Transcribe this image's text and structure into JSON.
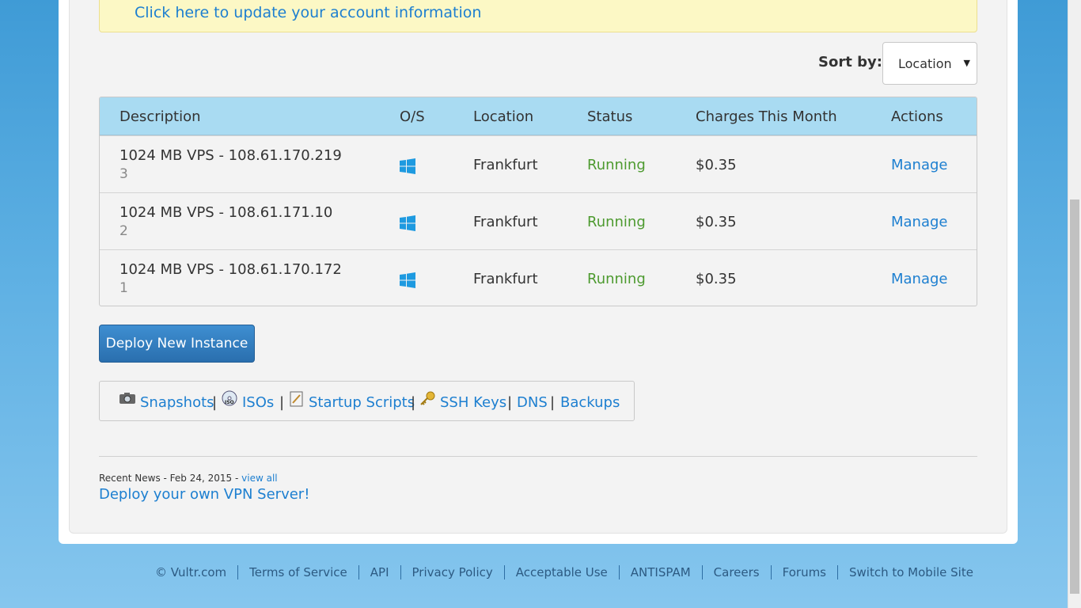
{
  "alert": {
    "link_text": "Click here to update your account information"
  },
  "sort": {
    "label": "Sort by:",
    "selected": "Location"
  },
  "table": {
    "headers": [
      "Description",
      "O/S",
      "Location",
      "Status",
      "Charges This Month",
      "Actions"
    ],
    "rows": [
      {
        "description": "1024 MB VPS - 108.61.170.219",
        "sub": "3",
        "os_icon": "windows-icon",
        "location": "Frankfurt",
        "status": "Running",
        "charges": "$0.35",
        "action": "Manage"
      },
      {
        "description": "1024 MB VPS - 108.61.171.10",
        "sub": "2",
        "os_icon": "windows-icon",
        "location": "Frankfurt",
        "status": "Running",
        "charges": "$0.35",
        "action": "Manage"
      },
      {
        "description": "1024 MB VPS - 108.61.170.172",
        "sub": "1",
        "os_icon": "windows-icon",
        "location": "Frankfurt",
        "status": "Running",
        "charges": "$0.35",
        "action": "Manage"
      }
    ]
  },
  "deploy_button": "Deploy New Instance",
  "tools": {
    "snapshots": "Snapshots",
    "isos": "ISOs",
    "startup_scripts": "Startup Scripts",
    "ssh_keys": "SSH Keys",
    "dns": "DNS",
    "backups": "Backups",
    "separator": "|"
  },
  "news": {
    "prefix": "Recent News - Feb 24, 2015 - ",
    "view_all": "view all",
    "title": "Deploy your own VPN Server!"
  },
  "footer": [
    "© Vultr.com",
    "Terms of Service",
    "API",
    "Privacy Policy",
    "Acceptable Use",
    "ANTISPAM",
    "Careers",
    "Forums",
    "Switch to Mobile Site"
  ],
  "colors": {
    "link": "#1d7fd0",
    "running": "#4d9a2f",
    "header_bg": "#a9dbf2",
    "button": "#2f7bc0"
  }
}
